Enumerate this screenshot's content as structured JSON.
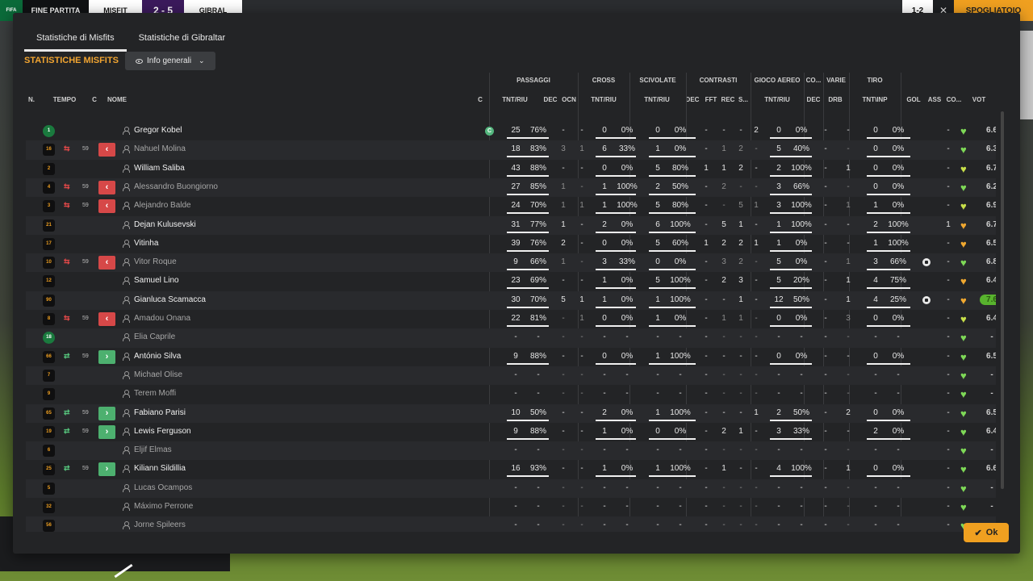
{
  "scoreboard": {
    "logo": "FIFA",
    "phase": "FINE PARTITA",
    "home": "MISFIT",
    "score": "2 - 5",
    "away": "GIBRAL"
  },
  "top_right": {
    "score": "1-2",
    "close_icon": "x-icon",
    "button": "SPOGLIATOIO"
  },
  "tabs": [
    {
      "label": "Statistiche di Misfits",
      "active": true
    },
    {
      "label": "Statistiche di Gibraltar",
      "active": false
    }
  ],
  "section_title": "STATISTICHE MISFITS",
  "view_selector": {
    "label": "Info generali",
    "icon": "eye-icon",
    "chevron": "chevron-down-icon"
  },
  "groups": [
    "PASSAGGI",
    "CROSS",
    "SCIVOLATE",
    "CONTRASTI",
    "GIOCO AEREO",
    "CO...",
    "VARIE",
    "TIRO"
  ],
  "columns": {
    "n": "N.",
    "tempo": "TEMPO",
    "c": "C",
    "nome": "NOME",
    "c2": "C",
    "pass_tnt": "TNT/RIU",
    "pass_dec": "DEC",
    "pass_ocn": "OCN",
    "cross_tnt": "TNT/RIU",
    "scv_tnt": "TNT/RIU",
    "con_dec": "DEC",
    "con_fft": "FFT",
    "con_rec": "REC",
    "con_s": "S...",
    "air_tnt": "TNT/RIU",
    "co_dec": "DEC",
    "var_drb": "DRB",
    "tiro_tnt": "TNT\\INP",
    "gol": "GOL",
    "ass": "ASS",
    "co": "CO...",
    "vot": "VOT"
  },
  "colors": {
    "accent": "#f2a531",
    "out": "#d64848",
    "in": "#4db06f",
    "heart_green": "#7ed957",
    "heart_lime": "#c8e04a",
    "heart_orange": "#f0a830"
  },
  "players": [
    {
      "num": "1",
      "gk": true,
      "sub": "",
      "min": "",
      "name": "Gregor Kobel",
      "active": true,
      "captain": "C",
      "pass": [
        "25",
        "76%"
      ],
      "pdec": "-",
      "pocn": "-",
      "cross": [
        "0",
        "0%"
      ],
      "scv": [
        "0",
        "0%"
      ],
      "cdec": "-",
      "cfft": "-",
      "crec": "-",
      "cs": "2",
      "air": [
        "0",
        "0%"
      ],
      "codec": "-",
      "drb": "-",
      "tiro": [
        "0",
        "0%"
      ],
      "gol": "",
      "ass": "-",
      "heart": "green",
      "vot": "6.6",
      "best": false
    },
    {
      "num": "16",
      "gk": false,
      "sub": "out",
      "min": "59",
      "name": "Nahuel Molina",
      "active": false,
      "captain": "",
      "pass": [
        "18",
        "83%"
      ],
      "pdec": "3",
      "pocn": "1",
      "cross": [
        "6",
        "33%"
      ],
      "scv": [
        "1",
        "0%"
      ],
      "cdec": "-",
      "cfft": "1",
      "crec": "2",
      "cs": "-",
      "air": [
        "5",
        "40%"
      ],
      "codec": "-",
      "drb": "-",
      "tiro": [
        "0",
        "0%"
      ],
      "gol": "",
      "ass": "-",
      "heart": "green",
      "vot": "6.3",
      "best": false
    },
    {
      "num": "2",
      "gk": false,
      "sub": "",
      "min": "",
      "name": "William Saliba",
      "active": true,
      "captain": "",
      "pass": [
        "43",
        "88%"
      ],
      "pdec": "-",
      "pocn": "-",
      "cross": [
        "0",
        "0%"
      ],
      "scv": [
        "5",
        "80%"
      ],
      "cdec": "1",
      "cfft": "1",
      "crec": "2",
      "cs": "-",
      "air": [
        "2",
        "100%"
      ],
      "codec": "-",
      "drb": "1",
      "tiro": [
        "0",
        "0%"
      ],
      "gol": "",
      "ass": "-",
      "heart": "lime",
      "vot": "6.7",
      "best": false
    },
    {
      "num": "4",
      "gk": false,
      "sub": "out",
      "min": "59",
      "name": "Alessandro Buongiorno",
      "active": false,
      "captain": "",
      "pass": [
        "27",
        "85%"
      ],
      "pdec": "1",
      "pocn": "-",
      "cross": [
        "1",
        "100%"
      ],
      "scv": [
        "2",
        "50%"
      ],
      "cdec": "-",
      "cfft": "2",
      "crec": "-",
      "cs": "-",
      "air": [
        "3",
        "66%"
      ],
      "codec": "-",
      "drb": "-",
      "tiro": [
        "0",
        "0%"
      ],
      "gol": "",
      "ass": "-",
      "heart": "green",
      "vot": "6.2",
      "best": false
    },
    {
      "num": "3",
      "gk": false,
      "sub": "out",
      "min": "59",
      "name": "Alejandro Balde",
      "active": false,
      "captain": "",
      "pass": [
        "24",
        "70%"
      ],
      "pdec": "1",
      "pocn": "1",
      "cross": [
        "1",
        "100%"
      ],
      "scv": [
        "5",
        "80%"
      ],
      "cdec": "-",
      "cfft": "-",
      "crec": "5",
      "cs": "1",
      "air": [
        "3",
        "100%"
      ],
      "codec": "-",
      "drb": "1",
      "tiro": [
        "1",
        "0%"
      ],
      "gol": "",
      "ass": "-",
      "heart": "lime",
      "vot": "6.9",
      "best": false
    },
    {
      "num": "21",
      "gk": false,
      "sub": "",
      "min": "",
      "name": "Dejan Kulusevski",
      "active": true,
      "captain": "",
      "pass": [
        "31",
        "77%"
      ],
      "pdec": "1",
      "pocn": "-",
      "cross": [
        "2",
        "0%"
      ],
      "scv": [
        "6",
        "100%"
      ],
      "cdec": "-",
      "cfft": "5",
      "crec": "1",
      "cs": "-",
      "air": [
        "1",
        "100%"
      ],
      "codec": "-",
      "drb": "-",
      "tiro": [
        "2",
        "100%"
      ],
      "gol": "",
      "ass": "1",
      "heart": "orange",
      "vot": "6.7",
      "best": false
    },
    {
      "num": "17",
      "gk": false,
      "sub": "",
      "min": "",
      "name": "Vitinha",
      "active": true,
      "captain": "",
      "pass": [
        "39",
        "76%"
      ],
      "pdec": "2",
      "pocn": "-",
      "cross": [
        "0",
        "0%"
      ],
      "scv": [
        "5",
        "60%"
      ],
      "cdec": "1",
      "cfft": "2",
      "crec": "2",
      "cs": "1",
      "air": [
        "1",
        "0%"
      ],
      "codec": "-",
      "drb": "-",
      "tiro": [
        "1",
        "100%"
      ],
      "gol": "",
      "ass": "-",
      "heart": "orange",
      "vot": "6.5",
      "best": false
    },
    {
      "num": "10",
      "gk": false,
      "sub": "out",
      "min": "59",
      "name": "Vitor Roque",
      "active": false,
      "captain": "",
      "pass": [
        "9",
        "66%"
      ],
      "pdec": "1",
      "pocn": "-",
      "cross": [
        "3",
        "33%"
      ],
      "scv": [
        "0",
        "0%"
      ],
      "cdec": "-",
      "cfft": "3",
      "crec": "2",
      "cs": "-",
      "air": [
        "5",
        "0%"
      ],
      "codec": "-",
      "drb": "1",
      "tiro": [
        "3",
        "66%"
      ],
      "gol": "ball",
      "ass": "-",
      "heart": "green",
      "vot": "6.8",
      "best": false
    },
    {
      "num": "12",
      "gk": false,
      "sub": "",
      "min": "",
      "name": "Samuel Lino",
      "active": true,
      "captain": "",
      "pass": [
        "23",
        "69%"
      ],
      "pdec": "-",
      "pocn": "-",
      "cross": [
        "1",
        "0%"
      ],
      "scv": [
        "5",
        "100%"
      ],
      "cdec": "-",
      "cfft": "2",
      "crec": "3",
      "cs": "-",
      "air": [
        "5",
        "20%"
      ],
      "codec": "-",
      "drb": "1",
      "tiro": [
        "4",
        "75%"
      ],
      "gol": "",
      "ass": "-",
      "heart": "orange",
      "vot": "6.4",
      "best": false
    },
    {
      "num": "90",
      "gk": false,
      "sub": "",
      "min": "",
      "name": "Gianluca Scamacca",
      "active": true,
      "captain": "",
      "pass": [
        "30",
        "70%"
      ],
      "pdec": "5",
      "pocn": "1",
      "cross": [
        "1",
        "0%"
      ],
      "scv": [
        "1",
        "100%"
      ],
      "cdec": "-",
      "cfft": "-",
      "crec": "1",
      "cs": "-",
      "air": [
        "12",
        "50%"
      ],
      "codec": "-",
      "drb": "1",
      "tiro": [
        "4",
        "25%"
      ],
      "gol": "ball",
      "ass": "-",
      "heart": "orange",
      "vot": "7.6",
      "best": true
    },
    {
      "num": "8",
      "gk": false,
      "sub": "out",
      "min": "59",
      "name": "Amadou Onana",
      "active": false,
      "captain": "",
      "pass": [
        "22",
        "81%"
      ],
      "pdec": "-",
      "pocn": "1",
      "cross": [
        "0",
        "0%"
      ],
      "scv": [
        "1",
        "0%"
      ],
      "cdec": "-",
      "cfft": "1",
      "crec": "1",
      "cs": "-",
      "air": [
        "0",
        "0%"
      ],
      "codec": "-",
      "drb": "3",
      "tiro": [
        "0",
        "0%"
      ],
      "gol": "",
      "ass": "-",
      "heart": "lime",
      "vot": "6.4",
      "best": false
    },
    {
      "num": "18",
      "gk": true,
      "sub": "",
      "min": "",
      "name": "Elia Caprile",
      "active": false,
      "captain": "",
      "pass": [
        "-",
        "-"
      ],
      "pdec": "-",
      "pocn": "-",
      "cross": [
        "-",
        "-"
      ],
      "scv": [
        "-",
        "-"
      ],
      "cdec": "-",
      "cfft": "-",
      "crec": "-",
      "cs": "-",
      "air": [
        "-",
        "-"
      ],
      "codec": "-",
      "drb": "-",
      "tiro": [
        "-",
        "-"
      ],
      "gol": "",
      "ass": "-",
      "heart": "green",
      "vot": "-",
      "best": false
    },
    {
      "num": "66",
      "gk": false,
      "sub": "in",
      "min": "59",
      "name": "António Silva",
      "active": true,
      "captain": "",
      "pass": [
        "9",
        "88%"
      ],
      "pdec": "-",
      "pocn": "-",
      "cross": [
        "0",
        "0%"
      ],
      "scv": [
        "1",
        "100%"
      ],
      "cdec": "-",
      "cfft": "-",
      "crec": "-",
      "cs": "-",
      "air": [
        "0",
        "0%"
      ],
      "codec": "-",
      "drb": "-",
      "tiro": [
        "0",
        "0%"
      ],
      "gol": "",
      "ass": "-",
      "heart": "green",
      "vot": "6.5",
      "best": false
    },
    {
      "num": "7",
      "gk": false,
      "sub": "",
      "min": "",
      "name": "Michael Olise",
      "active": false,
      "captain": "",
      "pass": [
        "-",
        "-"
      ],
      "pdec": "-",
      "pocn": "-",
      "cross": [
        "-",
        "-"
      ],
      "scv": [
        "-",
        "-"
      ],
      "cdec": "-",
      "cfft": "-",
      "crec": "-",
      "cs": "-",
      "air": [
        "-",
        "-"
      ],
      "codec": "-",
      "drb": "-",
      "tiro": [
        "-",
        "-"
      ],
      "gol": "",
      "ass": "-",
      "heart": "green",
      "vot": "-",
      "best": false
    },
    {
      "num": "9",
      "gk": false,
      "sub": "",
      "min": "",
      "name": "Terem Moffi",
      "active": false,
      "captain": "",
      "pass": [
        "-",
        "-"
      ],
      "pdec": "-",
      "pocn": "-",
      "cross": [
        "-",
        "-"
      ],
      "scv": [
        "-",
        "-"
      ],
      "cdec": "-",
      "cfft": "-",
      "crec": "-",
      "cs": "-",
      "air": [
        "-",
        "-"
      ],
      "codec": "-",
      "drb": "-",
      "tiro": [
        "-",
        "-"
      ],
      "gol": "",
      "ass": "-",
      "heart": "green",
      "vot": "-",
      "best": false
    },
    {
      "num": "65",
      "gk": false,
      "sub": "in",
      "min": "59",
      "name": "Fabiano Parisi",
      "active": true,
      "captain": "",
      "pass": [
        "10",
        "50%"
      ],
      "pdec": "-",
      "pocn": "-",
      "cross": [
        "2",
        "0%"
      ],
      "scv": [
        "1",
        "100%"
      ],
      "cdec": "-",
      "cfft": "-",
      "crec": "-",
      "cs": "1",
      "air": [
        "2",
        "50%"
      ],
      "codec": "-",
      "drb": "2",
      "tiro": [
        "0",
        "0%"
      ],
      "gol": "",
      "ass": "-",
      "heart": "green",
      "vot": "6.5",
      "best": false
    },
    {
      "num": "19",
      "gk": false,
      "sub": "in",
      "min": "59",
      "name": "Lewis Ferguson",
      "active": true,
      "captain": "",
      "pass": [
        "9",
        "88%"
      ],
      "pdec": "-",
      "pocn": "-",
      "cross": [
        "1",
        "0%"
      ],
      "scv": [
        "0",
        "0%"
      ],
      "cdec": "-",
      "cfft": "2",
      "crec": "1",
      "cs": "-",
      "air": [
        "3",
        "33%"
      ],
      "codec": "-",
      "drb": "-",
      "tiro": [
        "2",
        "0%"
      ],
      "gol": "",
      "ass": "-",
      "heart": "green",
      "vot": "6.4",
      "best": false
    },
    {
      "num": "6",
      "gk": false,
      "sub": "",
      "min": "",
      "name": "Eljif Elmas",
      "active": false,
      "captain": "",
      "pass": [
        "-",
        "-"
      ],
      "pdec": "-",
      "pocn": "-",
      "cross": [
        "-",
        "-"
      ],
      "scv": [
        "-",
        "-"
      ],
      "cdec": "-",
      "cfft": "-",
      "crec": "-",
      "cs": "-",
      "air": [
        "-",
        "-"
      ],
      "codec": "-",
      "drb": "-",
      "tiro": [
        "-",
        "-"
      ],
      "gol": "",
      "ass": "-",
      "heart": "green",
      "vot": "-",
      "best": false
    },
    {
      "num": "25",
      "gk": false,
      "sub": "in",
      "min": "59",
      "name": "Kiliann Sildillia",
      "active": true,
      "captain": "",
      "pass": [
        "16",
        "93%"
      ],
      "pdec": "-",
      "pocn": "-",
      "cross": [
        "1",
        "0%"
      ],
      "scv": [
        "1",
        "100%"
      ],
      "cdec": "-",
      "cfft": "1",
      "crec": "-",
      "cs": "-",
      "air": [
        "4",
        "100%"
      ],
      "codec": "-",
      "drb": "1",
      "tiro": [
        "0",
        "0%"
      ],
      "gol": "",
      "ass": "-",
      "heart": "green",
      "vot": "6.6",
      "best": false
    },
    {
      "num": "5",
      "gk": false,
      "sub": "",
      "min": "",
      "name": "Lucas Ocampos",
      "active": false,
      "captain": "",
      "pass": [
        "-",
        "-"
      ],
      "pdec": "-",
      "pocn": "-",
      "cross": [
        "-",
        "-"
      ],
      "scv": [
        "-",
        "-"
      ],
      "cdec": "-",
      "cfft": "-",
      "crec": "-",
      "cs": "-",
      "air": [
        "-",
        "-"
      ],
      "codec": "-",
      "drb": "-",
      "tiro": [
        "-",
        "-"
      ],
      "gol": "",
      "ass": "-",
      "heart": "green",
      "vot": "-",
      "best": false
    },
    {
      "num": "32",
      "gk": false,
      "sub": "",
      "min": "",
      "name": "Máximo Perrone",
      "active": false,
      "captain": "",
      "pass": [
        "-",
        "-"
      ],
      "pdec": "-",
      "pocn": "-",
      "cross": [
        "-",
        "-"
      ],
      "scv": [
        "-",
        "-"
      ],
      "cdec": "-",
      "cfft": "-",
      "crec": "-",
      "cs": "-",
      "air": [
        "-",
        "-"
      ],
      "codec": "-",
      "drb": "-",
      "tiro": [
        "-",
        "-"
      ],
      "gol": "",
      "ass": "-",
      "heart": "green",
      "vot": "-",
      "best": false
    },
    {
      "num": "56",
      "gk": false,
      "sub": "",
      "min": "",
      "name": "Jorne Spileers",
      "active": false,
      "captain": "",
      "pass": [
        "-",
        "-"
      ],
      "pdec": "-",
      "pocn": "-",
      "cross": [
        "-",
        "-"
      ],
      "scv": [
        "-",
        "-"
      ],
      "cdec": "-",
      "cfft": "-",
      "crec": "-",
      "cs": "-",
      "air": [
        "-",
        "-"
      ],
      "codec": "-",
      "drb": "-",
      "tiro": [
        "-",
        "-"
      ],
      "gol": "",
      "ass": "-",
      "heart": "green",
      "vot": "-",
      "best": false
    }
  ],
  "ok_button": {
    "label": "Ok",
    "icon": "check-icon"
  }
}
